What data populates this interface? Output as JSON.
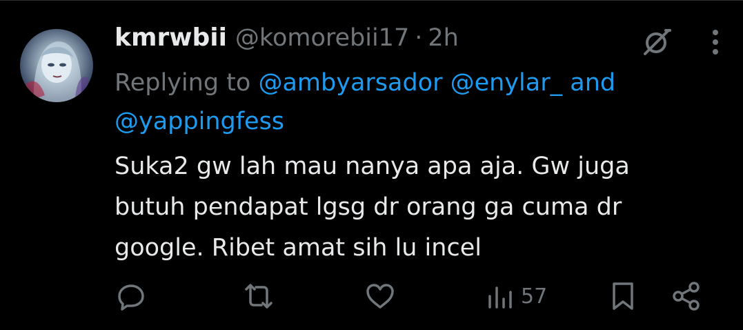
{
  "tweet": {
    "display_name": "kmrwbii",
    "handle": "@komorebii17",
    "separator": "·",
    "time": "2h",
    "replying_prefix": "Replying to",
    "mentions": [
      "@ambyarsador",
      "@enylar_",
      "@yappingfess"
    ],
    "mention_joiner": "and",
    "text": "Suka2 gw lah mau nanya apa aja. Gw juga\nbutuh pendapat lgsg dr orang ga cuma dr\ngoogle. Ribet amat sih lu incel",
    "views": "57"
  },
  "icons": {
    "avatar": "avatar",
    "grok": "grok-icon",
    "more": "more-vertical-icon",
    "reply": "reply-icon",
    "retweet": "retweet-icon",
    "like": "heart-icon",
    "views": "views-bar-chart-icon",
    "bookmark": "bookmark-icon",
    "share": "share-icon"
  },
  "colors": {
    "background": "#000000",
    "text": "#e7e9ea",
    "muted": "#71767b",
    "link": "#1d9bf0"
  }
}
